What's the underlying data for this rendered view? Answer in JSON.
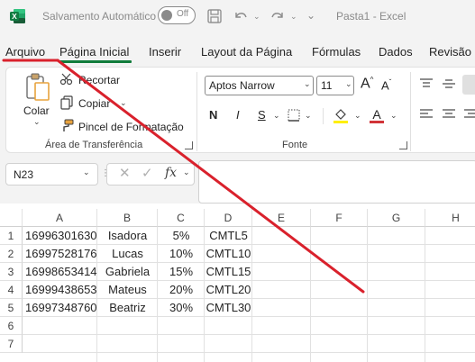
{
  "titlebar": {
    "autosave_label": "Salvamento Automático",
    "toggle_label": "Off",
    "doc_title": "Pasta1 - Excel"
  },
  "tabs": [
    "Arquivo",
    "Página Inicial",
    "Inserir",
    "Layout da Página",
    "Fórmulas",
    "Dados",
    "Revisão"
  ],
  "active_tab": "Página Inicial",
  "ribbon": {
    "clipboard": {
      "paste_label": "Colar",
      "cut_label": "Recortar",
      "copy_label": "Copiar",
      "format_painter_label": "Pincel de Formatação",
      "group_label": "Área de Transferência"
    },
    "font": {
      "font_name": "Aptos Narrow",
      "font_size": "11",
      "group_label": "Fonte",
      "bold": "N",
      "italic": "I",
      "underline": "S"
    }
  },
  "formula_bar": {
    "name_box": "N23",
    "fx_label": "fx",
    "formula": ""
  },
  "sheet": {
    "columns": [
      "A",
      "B",
      "C",
      "D",
      "E",
      "F",
      "G",
      "H"
    ],
    "rows": [
      "1",
      "2",
      "3",
      "4",
      "5",
      "6",
      "7"
    ],
    "data": [
      [
        "16996301630",
        "Isadora",
        "5%",
        "CMTL5"
      ],
      [
        "16997528176",
        "Lucas",
        "10%",
        "CMTL10"
      ],
      [
        "16998653414",
        "Gabriela",
        "15%",
        "CMTL15"
      ],
      [
        "16999438653",
        "Mateus",
        "20%",
        "CMTL20"
      ],
      [
        "16997348760",
        "Beatriz",
        "30%",
        "CMTL30"
      ]
    ]
  },
  "colors": {
    "excel_green": "#117c3b",
    "annotation_red": "#d9212c"
  }
}
